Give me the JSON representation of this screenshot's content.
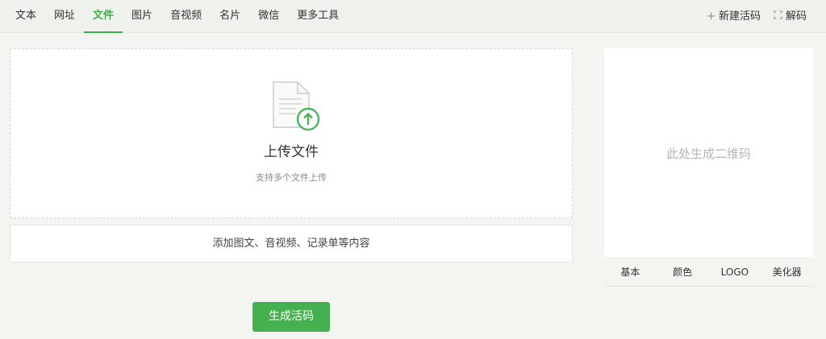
{
  "nav": {
    "tabs": [
      {
        "label": "文本"
      },
      {
        "label": "网址"
      },
      {
        "label": "文件"
      },
      {
        "label": "图片"
      },
      {
        "label": "音视频"
      },
      {
        "label": "名片"
      },
      {
        "label": "微信"
      },
      {
        "label": "更多工具"
      }
    ],
    "active_tab": "文件",
    "actions": {
      "new_live_code": {
        "icon": "plus-icon",
        "label": "新建活码"
      },
      "decode": {
        "icon": "scan-icon",
        "label": "解码"
      }
    }
  },
  "upload": {
    "icon": "file-upload-icon",
    "title": "上传文件",
    "subtitle": "支持多个文件上传"
  },
  "add_content_label": "添加图文、音视频、记录单等内容",
  "generate_button_label": "生成活码",
  "qr_panel": {
    "placeholder": "此处生成二维码",
    "style_tabs": [
      {
        "label": "基本"
      },
      {
        "label": "颜色"
      },
      {
        "label": "LOGO"
      },
      {
        "label": "美化器"
      }
    ]
  },
  "colors": {
    "accent": "#3fab49",
    "button": "#45b04f",
    "background": "#f2f5f0"
  }
}
